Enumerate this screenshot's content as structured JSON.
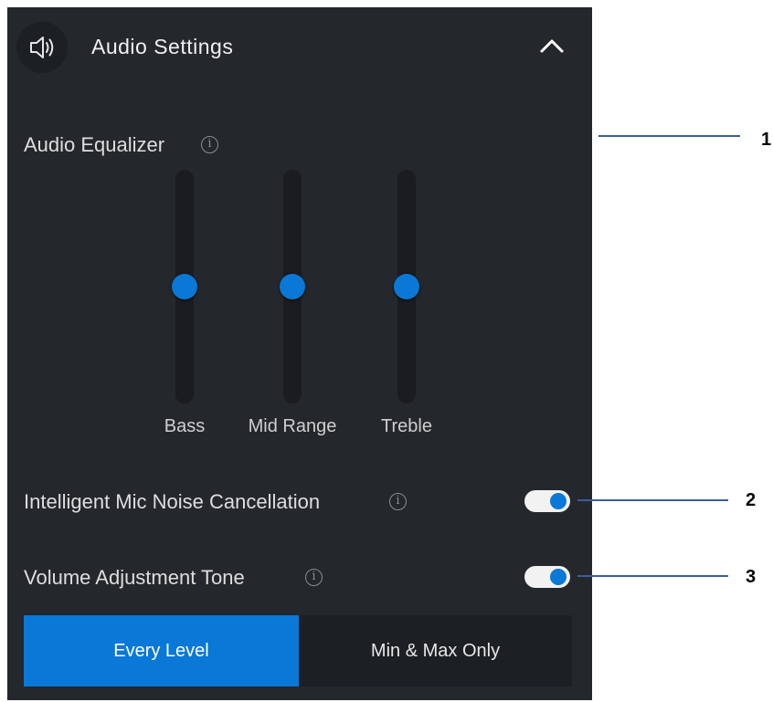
{
  "header": {
    "title": "Audio Settings",
    "speaker_icon": "speaker-icon",
    "collapse_icon": "chevron-up-icon"
  },
  "equalizer": {
    "label": "Audio Equalizer",
    "info_glyph": "i",
    "sliders": [
      {
        "label": "Bass",
        "level": 0.5
      },
      {
        "label": "Mid Range",
        "level": 0.5
      },
      {
        "label": "Treble",
        "level": 0.5
      }
    ]
  },
  "mic_noise": {
    "label": "Intelligent Mic Noise Cancellation",
    "info_glyph": "i",
    "enabled": true
  },
  "volume_tone": {
    "label": "Volume Adjustment Tone",
    "info_glyph": "i",
    "enabled": true,
    "options": [
      "Every Level",
      "Min & Max Only"
    ],
    "selected": "Every Level"
  },
  "callouts": [
    "1",
    "2",
    "3"
  ],
  "colors": {
    "panel_bg": "#24272c",
    "accent": "#0a78d6",
    "callout_line": "#3a5e9e"
  }
}
